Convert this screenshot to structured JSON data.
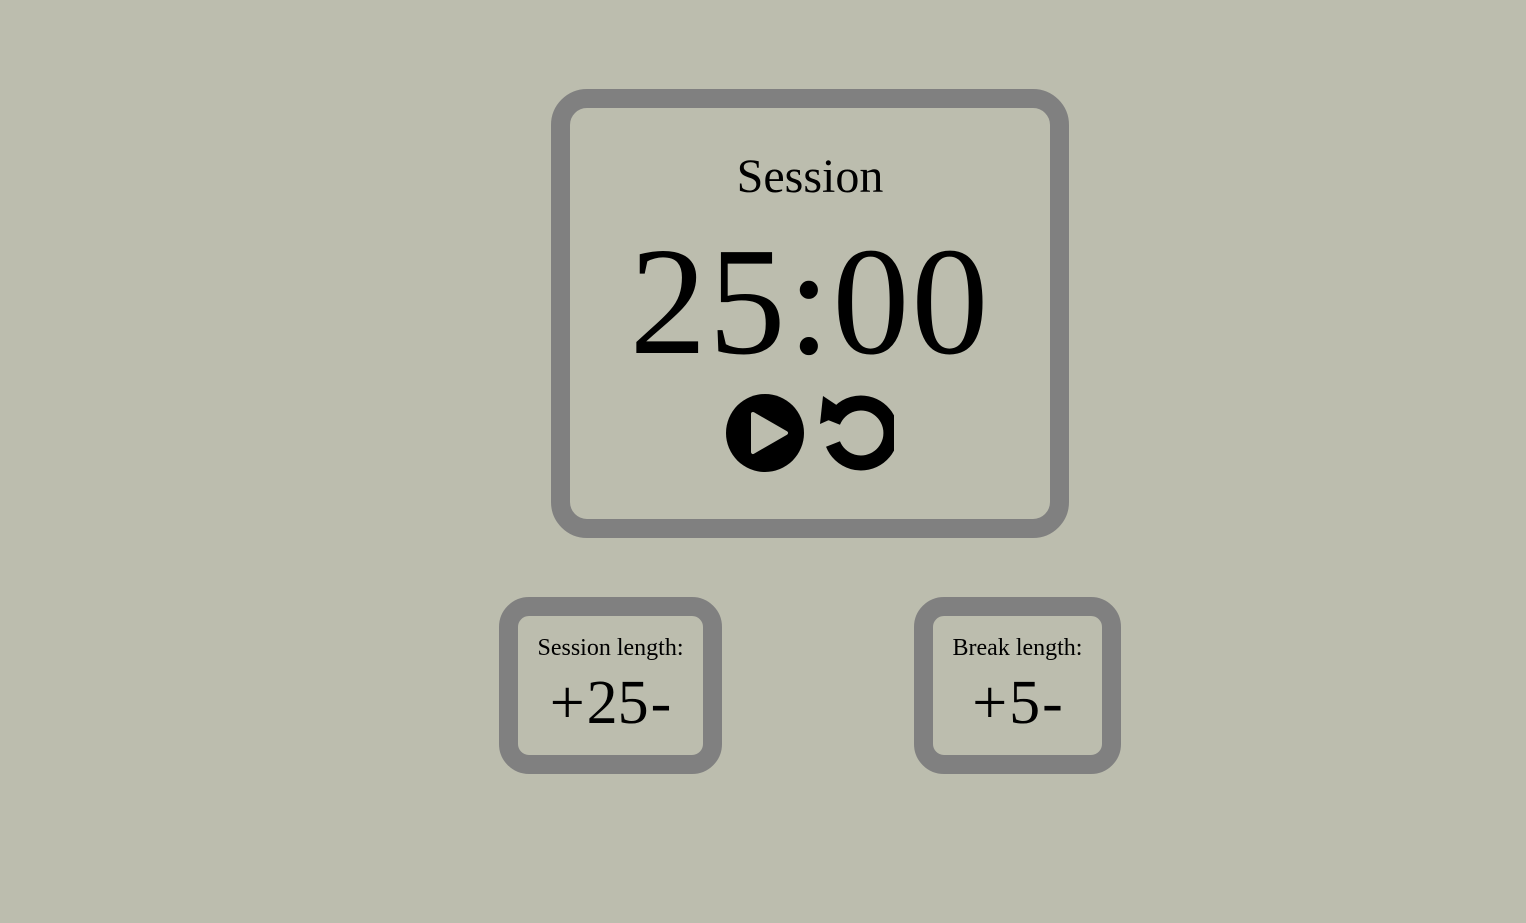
{
  "timer": {
    "label": "Session",
    "display": "25:00",
    "controls": {
      "play_icon": "play-circle-icon",
      "reset_icon": "reset-circle-icon"
    }
  },
  "session_length": {
    "label": "Session length:",
    "increment_label": "+",
    "value": "25",
    "decrement_label": "-"
  },
  "break_length": {
    "label": "Break length:",
    "increment_label": "+",
    "value": "5",
    "decrement_label": "-"
  },
  "colors": {
    "background": "#bcbdae",
    "frame": "#808080",
    "text": "#000000"
  }
}
